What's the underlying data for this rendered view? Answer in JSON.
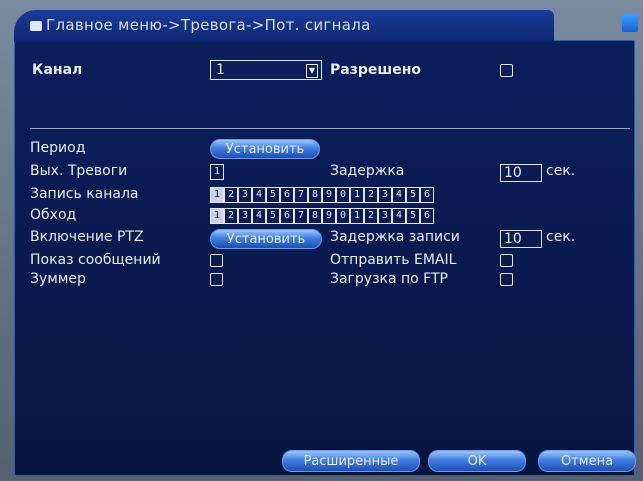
{
  "window": {
    "breadcrumb": "Главное меню->Тревога->Пот. сигнала"
  },
  "form": {
    "channel_label": "Канал",
    "channel_value": "1",
    "enabled_label": "Разрешено",
    "period_label": "Период",
    "period_button": "Установить",
    "alarm_out_label": "Вых. Тревоги",
    "delay_label": "Задержка",
    "delay_value": "10",
    "sec": "сек.",
    "record_label": "Запись канала",
    "tour_label": "Обход",
    "channel_numbers": [
      "1",
      "2",
      "3",
      "4",
      "5",
      "6",
      "7",
      "8",
      "9",
      "10",
      "11",
      "12",
      "13",
      "14",
      "15",
      "16"
    ],
    "ptz_label": "Включение PTZ",
    "ptz_button": "Установить",
    "record_delay_label": "Задержка записи",
    "record_delay_value": "10",
    "show_message_label": "Показ сообщений",
    "send_email_label": "Отправить EMAIL",
    "buzzer_label": "Зуммер",
    "ftp_label": "Загрузка по FTP"
  },
  "buttons": {
    "advanced": "Расширенные",
    "ok": "OK",
    "cancel": "Отмена"
  }
}
